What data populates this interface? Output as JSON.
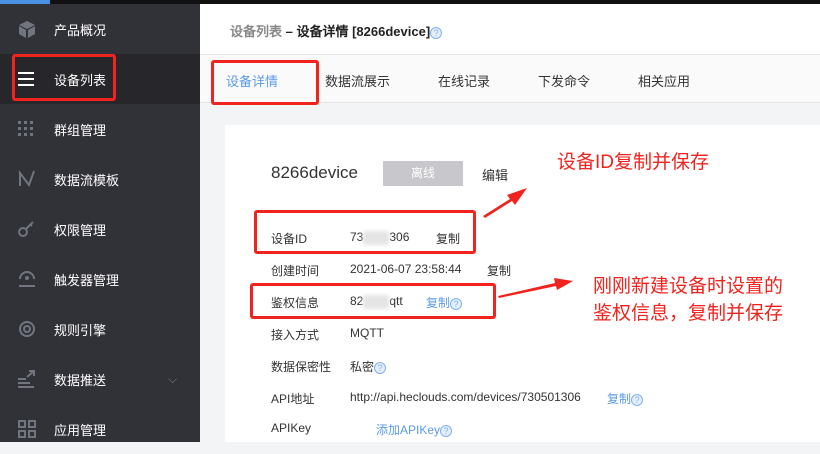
{
  "sidebar": {
    "items": [
      {
        "label": "产品概况",
        "icon": "cube-icon"
      },
      {
        "label": "设备列表",
        "icon": "list-icon",
        "active": true
      },
      {
        "label": "群组管理",
        "icon": "grid-dots-icon"
      },
      {
        "label": "数据流模板",
        "icon": "stream-icon"
      },
      {
        "label": "权限管理",
        "icon": "key-icon"
      },
      {
        "label": "触发器管理",
        "icon": "trigger-icon"
      },
      {
        "label": "规则引擎",
        "icon": "rule-icon"
      },
      {
        "label": "数据推送",
        "icon": "push-icon",
        "expand": "chevron-down-icon"
      },
      {
        "label": "应用管理",
        "icon": "apps-icon"
      }
    ]
  },
  "header": {
    "crumb_parent": "设备列表",
    "separator": " – ",
    "crumb_current": "设备详情 [8266device]",
    "help": "?"
  },
  "tabs": [
    "设备详情",
    "数据流展示",
    "在线记录",
    "下发命令",
    "相关应用"
  ],
  "device": {
    "name": "8266device",
    "status": "离线",
    "edit": "编辑",
    "rows": [
      {
        "label": "设备ID",
        "value_prefix": "73",
        "value_suffix": "306",
        "action": "复制"
      },
      {
        "label": "创建时间",
        "value": "2021-06-07 23:58:44",
        "action": "复制"
      },
      {
        "label": "鉴权信息",
        "value_prefix": "82",
        "value_suffix": "qtt",
        "action": "复制"
      },
      {
        "label": "接入方式",
        "value": "MQTT"
      },
      {
        "label": "数据保密性",
        "value": "私密"
      },
      {
        "label": "API地址",
        "value": "http://api.heclouds.com/devices/730501306",
        "action": "复制"
      },
      {
        "label": "APIKey",
        "action": "添加APIKey"
      }
    ]
  },
  "annotations": {
    "a1": "设备ID复制并保存",
    "a2_line1": "刚刚新建设备时设置的",
    "a2_line2": "鉴权信息，复制并保存"
  },
  "colors": {
    "accent": "#5b9be8",
    "sidebar": "#313138",
    "annotation": "#f0231e"
  }
}
